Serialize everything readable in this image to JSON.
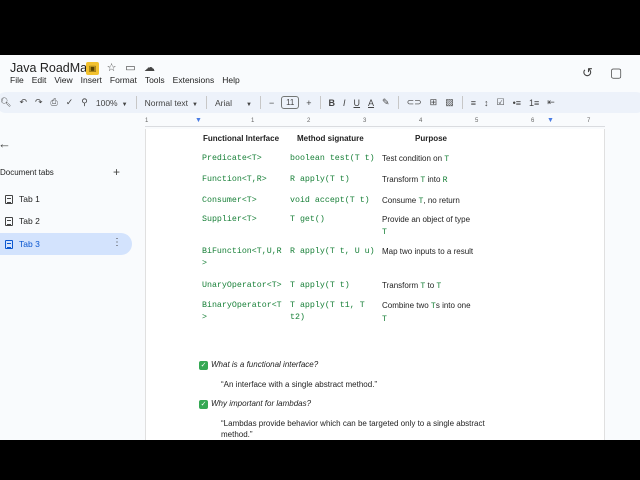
{
  "document": {
    "title": "Java RoadMap",
    "menu": [
      "File",
      "Edit",
      "View",
      "Insert",
      "Format",
      "Tools",
      "Extensions",
      "Help"
    ]
  },
  "toolbar": {
    "zoom": "100%",
    "style": "Normal text",
    "font": "Arial",
    "font_size": "11",
    "bold": "B",
    "italic": "I",
    "underline": "U",
    "text_color": "A"
  },
  "ruler": {
    "numbers": [
      "1",
      "1",
      "2",
      "3",
      "4",
      "5",
      "6",
      "7"
    ]
  },
  "sidebar": {
    "heading": "Document tabs",
    "tabs": [
      {
        "label": "Tab 1"
      },
      {
        "label": "Tab 2"
      },
      {
        "label": "Tab 3"
      }
    ]
  },
  "table": {
    "headers": [
      "Functional Interface",
      "Method signature",
      "Purpose"
    ],
    "rows": [
      {
        "iface": [
          "Predicate<T>"
        ],
        "sig": [
          "boolean test(T t)"
        ],
        "purpose": [
          [
            "Test condition on ",
            "T"
          ]
        ]
      },
      {
        "iface": [
          "Function<T,R>"
        ],
        "sig": [
          "R apply(T t)"
        ],
        "purpose": [
          [
            "Transform ",
            "T",
            " into ",
            "R"
          ]
        ]
      },
      {
        "iface": [
          "Consumer<T>"
        ],
        "sig": [
          "void accept(T t)"
        ],
        "purpose": [
          [
            "Consume ",
            "T",
            ", no return"
          ]
        ]
      },
      {
        "iface": [
          "Supplier<T>"
        ],
        "sig": [
          "T get()"
        ],
        "purpose": [
          [
            "Provide an object of type"
          ],
          [
            "",
            "T"
          ]
        ]
      },
      {
        "iface": [
          "BiFunction<T,U,R",
          ">"
        ],
        "sig": [
          "R apply(T t, U u)"
        ],
        "purpose": [
          [
            "Map two inputs to a result"
          ]
        ]
      },
      {
        "iface": [
          "UnaryOperator<T>"
        ],
        "sig": [
          "T apply(T t)"
        ],
        "purpose": [
          [
            "Transform ",
            "T",
            " to ",
            "T"
          ]
        ]
      },
      {
        "iface": [
          "BinaryOperator<T",
          ">"
        ],
        "sig": [
          "T apply(T t1, T",
          "t2)"
        ],
        "purpose": [
          [
            "Combine two ",
            "T",
            "s into one"
          ],
          [
            "",
            "T"
          ]
        ]
      }
    ]
  },
  "qa": [
    {
      "question": "What is a functional interface?",
      "answer": [
        "“An interface with a single abstract method.”"
      ]
    },
    {
      "question": "Why important for lambdas?",
      "answer": [
        "“Lambdas provide behavior which can be targeted only to a single abstract",
        "method.”"
      ]
    }
  ],
  "colors": {
    "code_green": "#188038",
    "active_tab_bg": "#d3e3fd",
    "active_tab_text": "#0b57d0",
    "check_green": "#34a853"
  }
}
